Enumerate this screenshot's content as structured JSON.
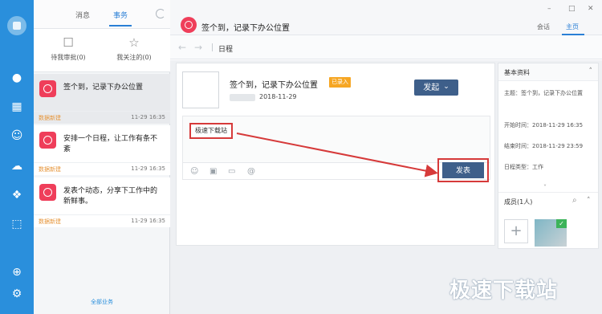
{
  "list_panel": {
    "tabs": {
      "messages": "消息",
      "affairs": "事务"
    },
    "quick": [
      {
        "label": "待我审批(0)",
        "icon": "clipboard-icon"
      },
      {
        "label": "我关注的(0)",
        "icon": "star-icon"
      }
    ],
    "cards": [
      {
        "title": "签个到，记录下办公位置",
        "tag": "数据新建",
        "time": "11-29 16:35"
      },
      {
        "title": "安排一个日程，让工作有条不紊",
        "tag": "数据新建",
        "time": "11-29 16:35"
      },
      {
        "title": "发表个动态，分享下工作中的新鲜事。",
        "tag": "数据新建",
        "time": "11-29 16:35"
      }
    ],
    "all_business": "全部业务"
  },
  "main": {
    "window_title": "签个到，记录下办公位置",
    "top_tabs": {
      "chat": "会话",
      "home": "主页"
    },
    "breadcrumb": "日程",
    "post": {
      "title": "签个到，记录下办公位置",
      "badge": "已录入",
      "date": "2018-11-29",
      "launch_label": "发起",
      "comment_value": "极速下载站",
      "publish_label": "发表"
    },
    "side": {
      "header": "基本资料",
      "subject": "主题：签个到，记录下办公位置",
      "start": "开始时间：2018-11-29 16:35",
      "end": "结束时间：2018-11-29 23:59",
      "type": "日程类型：工作",
      "members_label": "成员(1人)"
    }
  },
  "watermark": "极速下载站",
  "colors": {
    "rail": "#2a8fdc",
    "accent_tab": "#2a7fd6",
    "icon_red": "#ef3e5a",
    "button_navy": "#3e5f8a",
    "badge_orange": "#f6a623",
    "highlight_red": "#d63a3a"
  }
}
